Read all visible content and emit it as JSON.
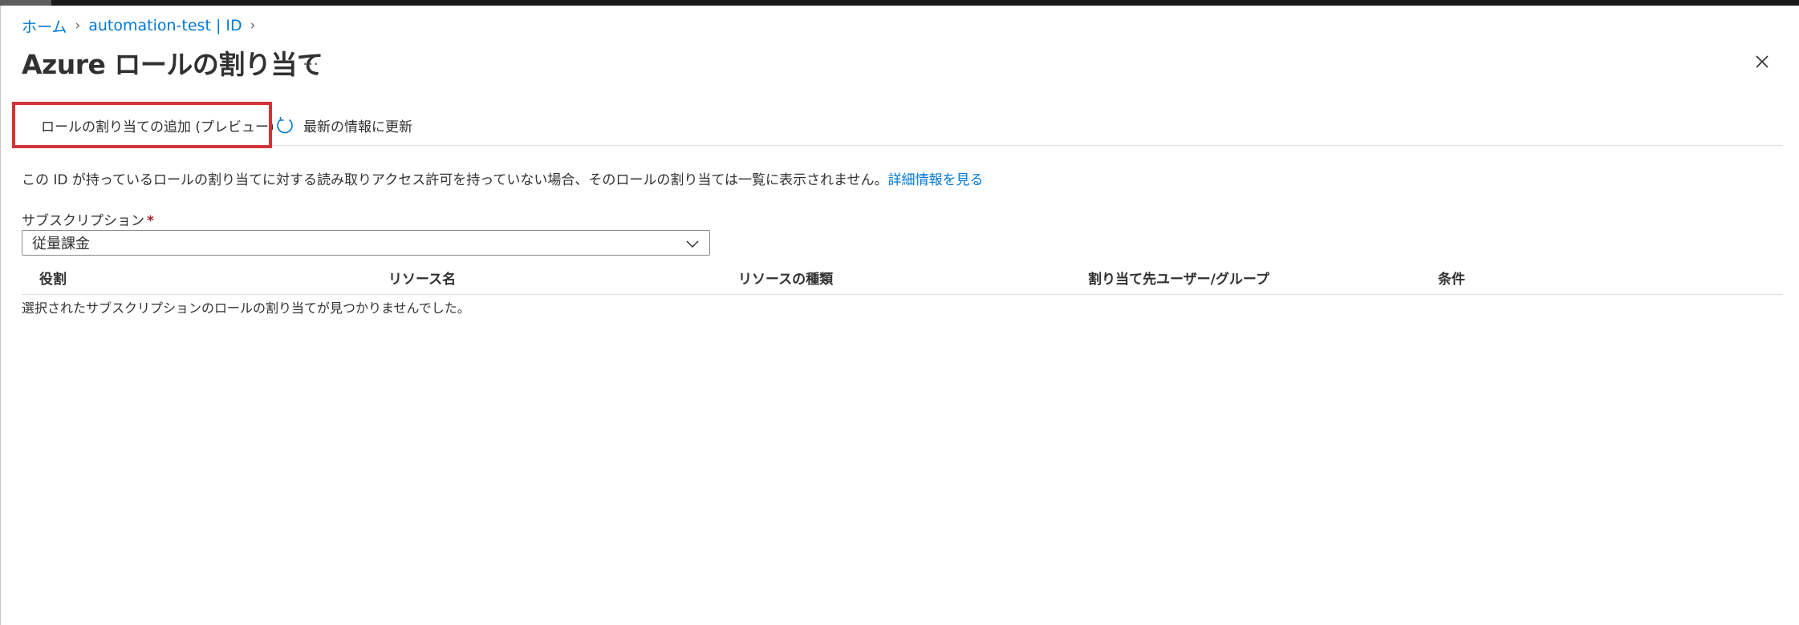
{
  "breadcrumb": {
    "home": "ホーム",
    "resource": "automation-test | ID"
  },
  "page": {
    "title": "Azure ロールの割り当て",
    "more": "…"
  },
  "toolbar": {
    "add_label": "ロールの割り当ての追加 (プレビュー)",
    "refresh_label": "最新の情報に更新"
  },
  "info": {
    "text": "この ID が持っているロールの割り当てに対する読み取りアクセス許可を持っていない場合、そのロールの割り当ては一覧に表示されません。",
    "link": "詳細情報を見る"
  },
  "subscription": {
    "label": "サブスクリプション",
    "required_mark": "*",
    "selected": "従量課金"
  },
  "table": {
    "columns": [
      "役割",
      "リソース名",
      "リソースの種類",
      "割り当て先ユーザー/グループ",
      "条件"
    ],
    "empty_message": "選択されたサブスクリプションのロールの割り当てが見つかりませんでした。"
  },
  "colors": {
    "link": "#0078d4",
    "highlight_border": "#d13438",
    "required": "#a4262c"
  },
  "icons": [
    "chevron-right-icon",
    "more-icon",
    "close-icon",
    "add-icon",
    "refresh-icon",
    "chevron-down-icon"
  ]
}
